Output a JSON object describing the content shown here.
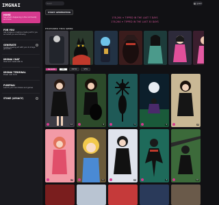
{
  "brand": {
    "logo": "IMGNAI"
  },
  "sidebar": {
    "items": [
      {
        "title": "Home",
        "desc": "See what's happening in the community and more",
        "active": true
      },
      {
        "title": "For You",
        "desc": "Get images & creations made just for you and what you are following",
        "active": false
      },
      {
        "title": "Generate",
        "desc": "Create amazing art with your AI image generator",
        "active": false
      },
      {
        "title": "Imgnai Chat",
        "desc": "Chat and create with AI",
        "active": false
      },
      {
        "title": "Imgnai Terminal",
        "desc": "Power user tools",
        "active": false
      },
      {
        "title": "Pumpnai",
        "desc": "Launch your own tokens and games",
        "active": false
      },
      {
        "title": "Stake (Legacy)",
        "desc": "",
        "active": false
      }
    ]
  },
  "topbar": {
    "search_placeholder": "Search",
    "user_label": "guest"
  },
  "actions": {
    "start_generating": "START GENERATING"
  },
  "ticker": {
    "line1": "178,264 ✦ TIPPED IN THE LAST 7 DAYS",
    "line2": "178,264 ✦ TIPPED IN THE LAST 30 DAYS"
  },
  "featured": {
    "label": "FEATURED THIS WEEK"
  },
  "filters": {
    "sort": "Recent",
    "options": [
      "ALL",
      "NSFW",
      "SFW"
    ]
  },
  "colors": {
    "accent": "#d63a8e",
    "bg": "#111114",
    "sidebar": "#1a1a1f"
  },
  "cards": [
    {
      "meta": "12"
    },
    {
      "meta": "8"
    },
    {
      "meta": "5"
    },
    {
      "meta": "9"
    },
    {
      "meta": "4"
    },
    {
      "meta": "7"
    },
    {
      "meta": "11"
    },
    {
      "meta": "6"
    },
    {
      "meta": "3"
    },
    {
      "meta": "10"
    }
  ]
}
